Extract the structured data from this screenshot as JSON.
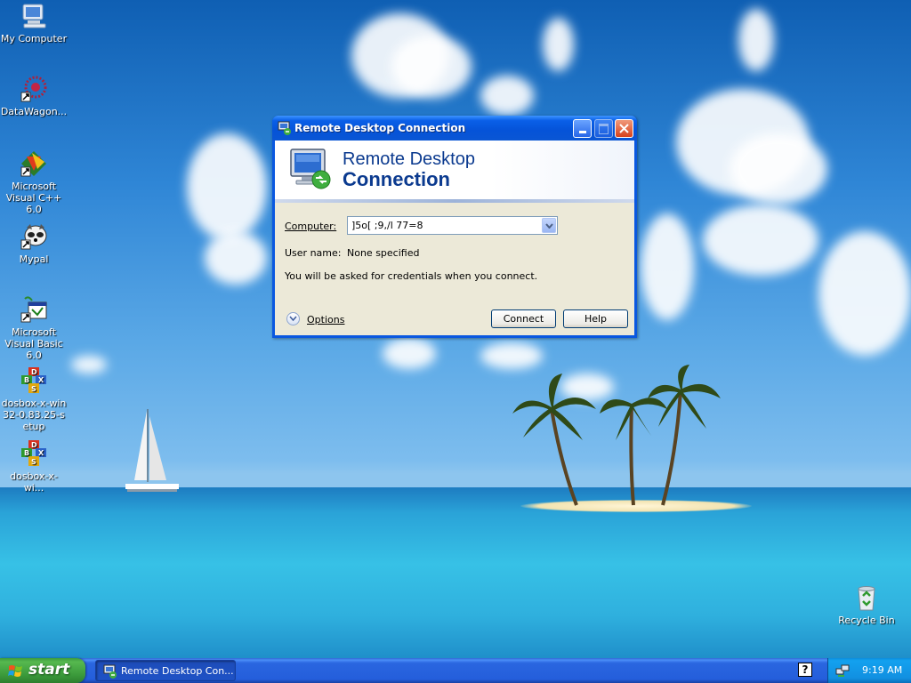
{
  "desktop": {
    "icons": [
      {
        "label": "My Computer",
        "icon": "my-computer-icon"
      },
      {
        "label": "DataWagon...",
        "icon": "datawagon-icon"
      },
      {
        "label": "Microsoft Visual C++ 6.0",
        "icon": "visual-cpp-icon"
      },
      {
        "label": "Mypal",
        "icon": "mypal-icon"
      },
      {
        "label": "Microsoft Visual Basic 6.0",
        "icon": "visual-basic-icon"
      },
      {
        "label": "dosbox-x-win32-0.83.25-setup",
        "icon": "dosbox-setup-icon"
      },
      {
        "label": "dosbox-x-wi...",
        "icon": "dosbox-icon"
      },
      {
        "label": "Recycle Bin",
        "icon": "recycle-bin-icon"
      }
    ]
  },
  "dialog": {
    "title": "Remote Desktop Connection",
    "banner_line1": "Remote Desktop",
    "banner_line2": "Connection",
    "computer_label": "Computer:",
    "computer_value": "]5o[ ;9,/l 77=8",
    "username_label": "User name:",
    "username_value": "None specified",
    "info_text": "You will be asked for credentials when you connect.",
    "options_label": "Options",
    "connect_label": "Connect",
    "help_label": "Help"
  },
  "taskbar": {
    "start_label": "start",
    "task_label": "Remote Desktop Con...",
    "clock": "9:19 AM",
    "help_icon_glyph": "?"
  },
  "colors": {
    "titlebar": "#0553d8",
    "dialog_bg": "#ece9d8",
    "banner_text": "#0b3a8f",
    "taskbar": "#245edb",
    "start": "#3a993a",
    "tray": "#1190e1"
  }
}
